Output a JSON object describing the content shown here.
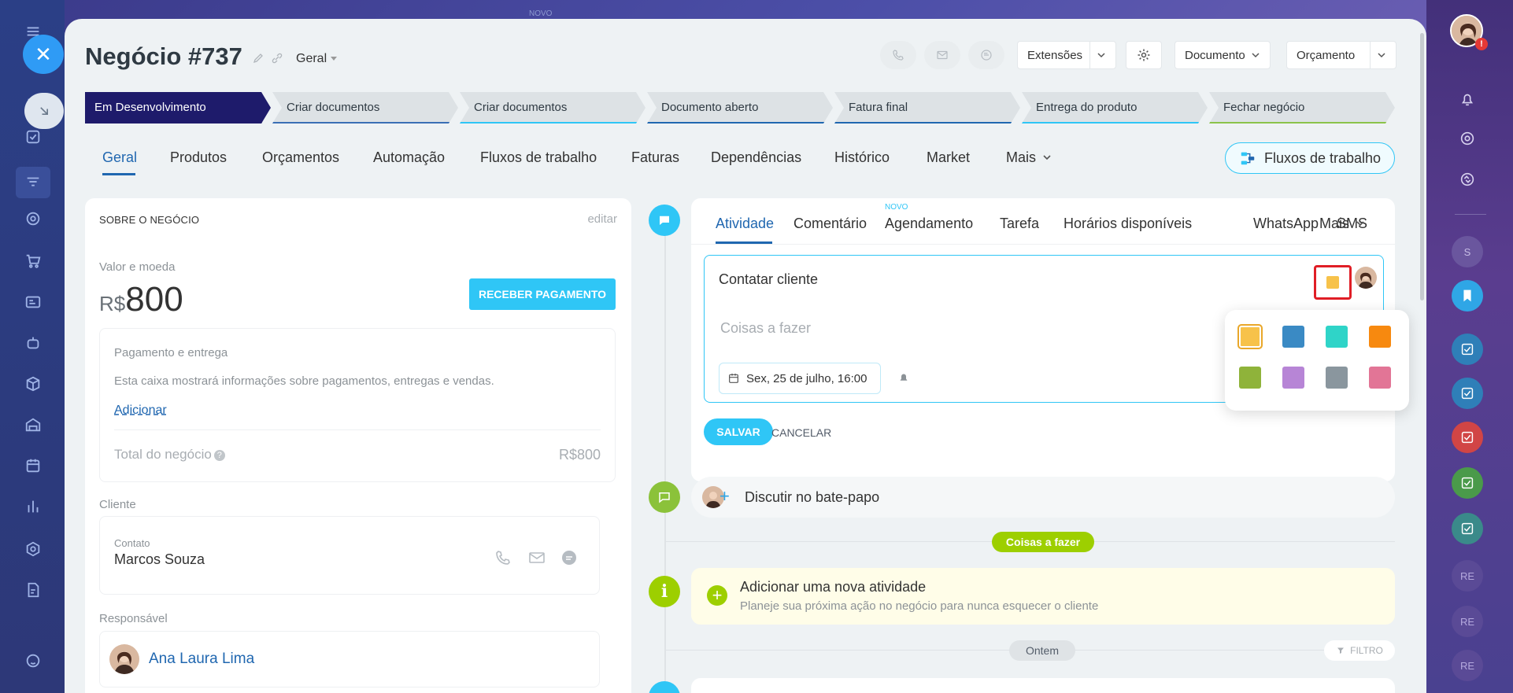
{
  "deal": {
    "title": "Negócio #737",
    "pipeline_label": "Geral",
    "top_badge": "NOVO"
  },
  "toolbar": {
    "extensions_label": "Extensões",
    "document_label": "Documento",
    "budget_label": "Orçamento"
  },
  "stages": [
    {
      "label": "Em Desenvolvimento",
      "color": "#1e1b6b",
      "active": true
    },
    {
      "label": "Criar documentos",
      "color": "#3a6fb5"
    },
    {
      "label": "Criar documentos",
      "color": "#2fc6f6"
    },
    {
      "label": "Documento aberto",
      "color": "#2067b0"
    },
    {
      "label": "Fatura final",
      "color": "#2067b0"
    },
    {
      "label": "Entrega do produto",
      "color": "#2fc6f6"
    },
    {
      "label": "Fechar negócio",
      "color": "#8bc34a"
    }
  ],
  "tabs": [
    "Geral",
    "Produtos",
    "Orçamentos",
    "Automação",
    "Fluxos de trabalho",
    "Faturas",
    "Dependências",
    "Histórico",
    "Market",
    "Mais"
  ],
  "workflows_button": "Fluxos de trabalho",
  "about": {
    "heading": "SOBRE O NEGÓCIO",
    "edit_link": "editar",
    "value_label": "Valor e moeda",
    "currency": "R$",
    "amount": "800",
    "receive_payment": "RECEBER PAGAMENTO",
    "payment_title": "Pagamento e entrega",
    "payment_desc": "Esta caixa mostrará informações sobre pagamentos, entregas e vendas.",
    "add_link": "Adicionar",
    "total_label": "Total do negócio",
    "total_value": "R$800"
  },
  "client": {
    "section_label": "Cliente",
    "contact_label": "Contato",
    "contact_name": "Marcos Souza"
  },
  "responsible": {
    "section_label": "Responsável",
    "name": "Ana Laura Lima"
  },
  "activity_tabs": {
    "items": [
      "Atividade",
      "Comentário",
      "Agendamento",
      "Tarefa",
      "Horários disponíveis",
      "WhatsApp",
      "SMS",
      "Mais"
    ],
    "new_badge": "NOVO"
  },
  "editor": {
    "title_value": "Contatar cliente",
    "body_placeholder": "Coisas a fazer",
    "date_value": "Sex, 25 de julho, 16:00",
    "save": "SALVAR",
    "cancel": "CANCELAR"
  },
  "color_picker": {
    "colors": [
      "#f7c24a",
      "#3a8ac4",
      "#2fd4c8",
      "#f7890f",
      "#8fb33a",
      "#b785d6",
      "#8a969e",
      "#e27596"
    ],
    "selected_index": 0
  },
  "chat": {
    "label": "Discutir no bate-papo"
  },
  "todo_badge": "Coisas a fazer",
  "new_activity": {
    "title": "Adicionar uma nova atividade",
    "subtitle": "Planeje sua próxima ação no negócio para nunca esquecer o cliente"
  },
  "yesterday_badge": "Ontem",
  "filter_label": "FILTRO",
  "right_bar": {
    "avatar_letters": [
      "S",
      "RE",
      "RE",
      "RE"
    ]
  }
}
